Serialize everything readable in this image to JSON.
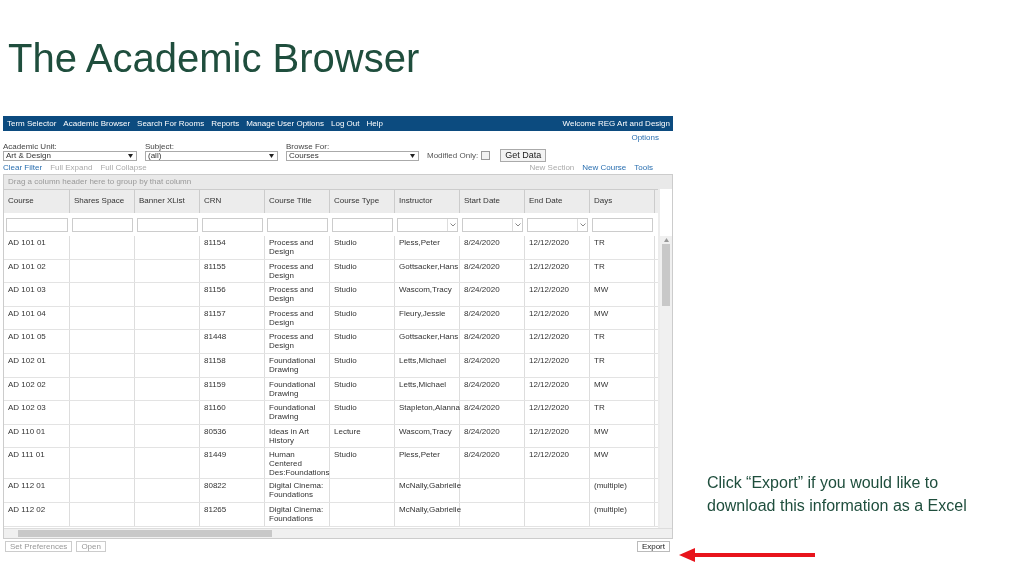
{
  "slide": {
    "title": "The Academic Browser",
    "note": "Click “Export” if you would like to download this information as a Excel"
  },
  "app": {
    "nav": [
      "Term Selector",
      "Academic Browser",
      "Search For Rooms",
      "Reports",
      "Manage User Options",
      "Log Out",
      "Help"
    ],
    "welcome": "Welcome REG Art and Design",
    "options_link": "Options",
    "filters": [
      {
        "label": "Academic Unit:",
        "value": "Art & Design"
      },
      {
        "label": "Subject:",
        "value": "(all)"
      },
      {
        "label": "Browse For:",
        "value": "Courses"
      }
    ],
    "modified_only": {
      "label": "Modified Only:",
      "checked": false
    },
    "get_data": "Get Data",
    "left_links": [
      {
        "label": "Clear Filter",
        "disabled": false
      },
      {
        "label": "Full Expand",
        "disabled": true
      },
      {
        "label": "Full Collapse",
        "disabled": true
      }
    ],
    "right_links": [
      {
        "label": "New Section",
        "disabled": true
      },
      {
        "label": "New Course",
        "disabled": false
      },
      {
        "label": "Tools",
        "disabled": false
      }
    ],
    "group_hint": "Drag a column header here to group by that column",
    "columns": [
      {
        "label": "Course",
        "kind": "text"
      },
      {
        "label": "Shares Space",
        "kind": "text"
      },
      {
        "label": "Banner XList",
        "kind": "text"
      },
      {
        "label": "CRN",
        "kind": "text"
      },
      {
        "label": "Course Title",
        "kind": "text"
      },
      {
        "label": "Course Type",
        "kind": "text"
      },
      {
        "label": "Instructor",
        "kind": "dropdown"
      },
      {
        "label": "Start Date",
        "kind": "dropdown"
      },
      {
        "label": "End Date",
        "kind": "dropdown"
      },
      {
        "label": "Days",
        "kind": "text"
      }
    ],
    "rows": [
      {
        "course": "AD 101 01",
        "crn": "81154",
        "title": "Process and Design",
        "type": "Studio",
        "instructor": "Pless,Peter",
        "start": "8/24/2020",
        "end": "12/12/2020",
        "days": "TR"
      },
      {
        "course": "AD 101 02",
        "crn": "81155",
        "title": "Process and Design",
        "type": "Studio",
        "instructor": "Gottsacker,Hans",
        "start": "8/24/2020",
        "end": "12/12/2020",
        "days": "TR"
      },
      {
        "course": "AD 101 03",
        "crn": "81156",
        "title": "Process and Design",
        "type": "Studio",
        "instructor": "Wascom,Tracy",
        "start": "8/24/2020",
        "end": "12/12/2020",
        "days": "MW"
      },
      {
        "course": "AD 101 04",
        "crn": "81157",
        "title": "Process and Design",
        "type": "Studio",
        "instructor": "Fleury,Jessie",
        "start": "8/24/2020",
        "end": "12/12/2020",
        "days": "MW"
      },
      {
        "course": "AD 101 05",
        "crn": "81448",
        "title": "Process and Design",
        "type": "Studio",
        "instructor": "Gottsacker,Hans",
        "start": "8/24/2020",
        "end": "12/12/2020",
        "days": "TR"
      },
      {
        "course": "AD 102 01",
        "crn": "81158",
        "title": "Foundational Drawing",
        "type": "Studio",
        "instructor": "Letts,Michael",
        "start": "8/24/2020",
        "end": "12/12/2020",
        "days": "TR"
      },
      {
        "course": "AD 102 02",
        "crn": "81159",
        "title": "Foundational Drawing",
        "type": "Studio",
        "instructor": "Letts,Michael",
        "start": "8/24/2020",
        "end": "12/12/2020",
        "days": "MW"
      },
      {
        "course": "AD 102 03",
        "crn": "81160",
        "title": "Foundational Drawing",
        "type": "Studio",
        "instructor": "Stapleton,Alanna",
        "start": "8/24/2020",
        "end": "12/12/2020",
        "days": "TR"
      },
      {
        "course": "AD 110 01",
        "crn": "80536",
        "title": "Ideas in Art History",
        "type": "Lecture",
        "instructor": "Wascom,Tracy",
        "start": "8/24/2020",
        "end": "12/12/2020",
        "days": "MW"
      },
      {
        "course": "AD 111 01",
        "crn": "81449",
        "title": "Human Centered Des:Foundations",
        "type": "Studio",
        "instructor": "Pless,Peter",
        "start": "8/24/2020",
        "end": "12/12/2020",
        "days": "MW"
      },
      {
        "course": "AD 112 01",
        "crn": "80822",
        "title": "Digital Cinema: Foundations",
        "instructor": "McNally,Gabrielle",
        "days": "(multiple)"
      },
      {
        "course": "AD 112 02",
        "crn": "81265",
        "title": "Digital Cinema: Foundations",
        "instructor": "McNally,Gabrielle",
        "days": "(multiple)"
      }
    ],
    "bottom_buttons": [
      {
        "label": "Set Preferences",
        "disabled": true
      },
      {
        "label": "Open",
        "disabled": true
      }
    ],
    "export": "Export"
  }
}
